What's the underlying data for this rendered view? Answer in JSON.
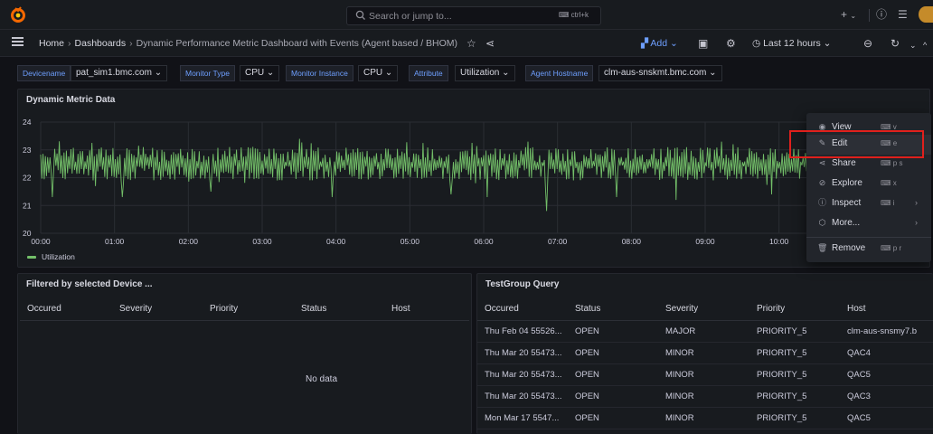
{
  "topbar": {
    "search_placeholder": "Search or jump to...",
    "search_shortcut": "ctrl+k",
    "plus_label": "+",
    "icons": [
      "grafana-logo-icon",
      "search-icon",
      "keyboard-icon",
      "plus-icon",
      "chevron-down-icon",
      "help-icon",
      "rss-icon",
      "avatar"
    ]
  },
  "navbar": {
    "breadcrumbs": [
      "Home",
      "Dashboards",
      "Dynamic Performance Metric Dashboard with Events (Agent based / BHOM)"
    ],
    "add_label": "Add",
    "time_range": "Last 12 hours"
  },
  "variables": [
    {
      "label": "Devicename",
      "value": "pat_sim1.bmc.com"
    },
    {
      "label": "Monitor Type",
      "value": "CPU"
    },
    {
      "label": "Monitor Instance",
      "value": "CPU"
    },
    {
      "label": "Attribute",
      "value": "Utilization"
    },
    {
      "label": "Agent Hostname",
      "value": "clm-aus-snskmt.bmc.com"
    }
  ],
  "metric_panel": {
    "title": "Dynamic Metric Data",
    "legend": "Utilization",
    "series_color": "#73bf69"
  },
  "chart_data": {
    "type": "line",
    "title": "Dynamic Metric Data",
    "xlabel": "",
    "ylabel": "",
    "x_ticks": [
      "00:00",
      "01:00",
      "02:00",
      "03:00",
      "04:00",
      "05:00",
      "06:00",
      "07:00",
      "08:00",
      "09:00",
      "10:00"
    ],
    "y_ticks": [
      20,
      21,
      22,
      23,
      24
    ],
    "ylim": [
      20,
      24
    ],
    "xlim_hours": [
      0,
      12
    ],
    "grid": true,
    "legend_position": "bottom-left",
    "series": [
      {
        "name": "Utilization",
        "color": "#73bf69",
        "summary": {
          "typical_low": 21.9,
          "typical_high": 23.1,
          "min_dip": 20.9,
          "max_spike": 23.4
        },
        "dips_hours": [
          0.15,
          1.1,
          2.3,
          3.95,
          5.55,
          6.05,
          6.85,
          7.8,
          8.6,
          9.9
        ],
        "dip_values": [
          21.3,
          21.3,
          21.5,
          21.3,
          21.4,
          21.3,
          20.8,
          21.3,
          21.2,
          21.4
        ]
      }
    ]
  },
  "events_panel": {
    "title": "Filtered by selected Device ...",
    "columns": [
      "Occured",
      "Severity",
      "Priority",
      "Status",
      "Host"
    ],
    "empty_text": "No data"
  },
  "testgroup_panel": {
    "title": "TestGroup Query",
    "columns": [
      "Occured",
      "Status",
      "Severity",
      "Priority",
      "Host"
    ],
    "rows": [
      [
        "Thu Feb 04 55526...",
        "OPEN",
        "MAJOR",
        "PRIORITY_5",
        "clm-aus-snsmy7.b"
      ],
      [
        "Thu Mar 20 55473...",
        "OPEN",
        "MINOR",
        "PRIORITY_5",
        "QAC4"
      ],
      [
        "Thu Mar 20 55473...",
        "OPEN",
        "MINOR",
        "PRIORITY_5",
        "QAC5"
      ],
      [
        "Thu Mar 20 55473...",
        "OPEN",
        "MINOR",
        "PRIORITY_5",
        "QAC3"
      ],
      [
        "Mon Mar 17 5547...",
        "OPEN",
        "MINOR",
        "PRIORITY_5",
        "QAC5"
      ]
    ]
  },
  "context_menu": {
    "items": [
      {
        "icon": "eye-icon",
        "label": "View",
        "shortcut": "v",
        "submenu": false
      },
      {
        "icon": "edit-icon",
        "label": "Edit",
        "shortcut": "e",
        "submenu": false
      },
      {
        "icon": "share-icon",
        "label": "Share",
        "shortcut": "p s",
        "submenu": false
      },
      {
        "icon": "compass-icon",
        "label": "Explore",
        "shortcut": "x",
        "submenu": false
      },
      {
        "icon": "info-icon",
        "label": "Inspect",
        "shortcut": "i",
        "submenu": true
      },
      {
        "icon": "cube-icon",
        "label": "More...",
        "shortcut": "",
        "submenu": true
      },
      {
        "icon": "trash-icon",
        "label": "Remove",
        "shortcut": "p r",
        "submenu": false
      }
    ],
    "highlight_color": "#e0201c"
  }
}
